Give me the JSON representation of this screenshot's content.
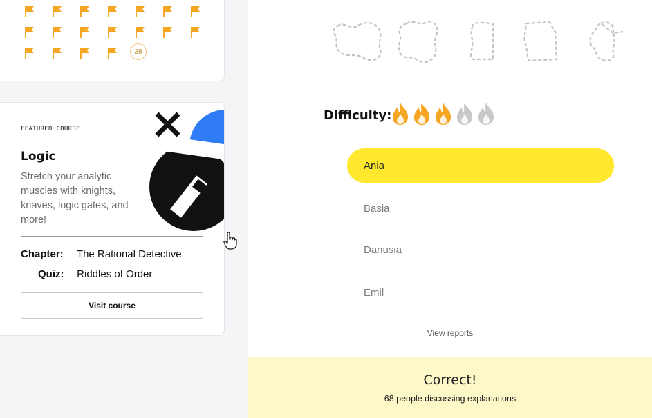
{
  "progress": {
    "flags": 18,
    "counter_label": "28"
  },
  "featured": {
    "eyebrow": "FEATURED COURSE",
    "title": "Logic",
    "description": "Stretch your analytic muscles with knights, knaves, logic gates, and more!",
    "chapter_label": "Chapter:",
    "chapter_value": "The Rational Detective",
    "quiz_label": "Quiz:",
    "quiz_value": "Riddles of Order",
    "visit_label": "Visit course"
  },
  "quiz": {
    "difficulty_label": "Difficulty:",
    "difficulty_level": 3,
    "difficulty_max": 5,
    "options": [
      {
        "label": "Ania",
        "selected": true
      },
      {
        "label": "Basia",
        "selected": false
      },
      {
        "label": "Danusia",
        "selected": false
      },
      {
        "label": "Emil",
        "selected": false
      }
    ],
    "view_reports": "View reports",
    "result_title": "Correct!",
    "result_sub": "68 people discussing explanations"
  },
  "colors": {
    "flag": "#f5a623",
    "flame_active": "#f5a623",
    "flame_inactive": "#c8c8c8",
    "selected_option": "#ffe82e",
    "result_bg": "#fdf8c8",
    "art_blue": "#2f7cf6"
  }
}
